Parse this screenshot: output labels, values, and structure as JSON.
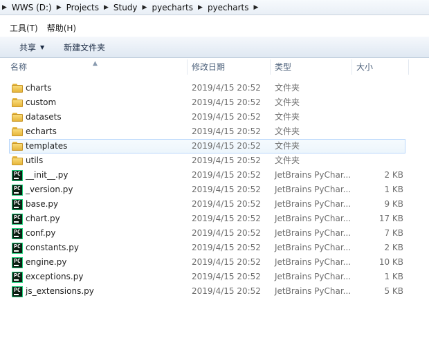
{
  "address": {
    "crumbs": [
      "WWS (D:)",
      "Projects",
      "Study",
      "pyecharts",
      "pyecharts"
    ]
  },
  "menu": {
    "items": [
      "工具(T)",
      "帮助(H)"
    ]
  },
  "toolbar": {
    "share_label": "共享",
    "new_folder_label": "新建文件夹"
  },
  "columns": {
    "name": "名称",
    "date": "修改日期",
    "type": "类型",
    "size": "大小"
  },
  "files": [
    {
      "name": "charts",
      "date": "2019/4/15 20:52",
      "type": "文件夹",
      "size": "",
      "icon": "folder-icon"
    },
    {
      "name": "custom",
      "date": "2019/4/15 20:52",
      "type": "文件夹",
      "size": "",
      "icon": "folder-icon"
    },
    {
      "name": "datasets",
      "date": "2019/4/15 20:52",
      "type": "文件夹",
      "size": "",
      "icon": "folder-icon"
    },
    {
      "name": "echarts",
      "date": "2019/4/15 20:52",
      "type": "文件夹",
      "size": "",
      "icon": "folder-icon"
    },
    {
      "name": "templates",
      "date": "2019/4/15 20:52",
      "type": "文件夹",
      "size": "",
      "icon": "folder-icon",
      "hover": true
    },
    {
      "name": "utils",
      "date": "2019/4/15 20:52",
      "type": "文件夹",
      "size": "",
      "icon": "folder-icon"
    },
    {
      "name": "__init__.py",
      "date": "2019/4/15 20:52",
      "type": "JetBrains PyChar...",
      "size": "2 KB",
      "icon": "pycharm-file-icon"
    },
    {
      "name": "_version.py",
      "date": "2019/4/15 20:52",
      "type": "JetBrains PyChar...",
      "size": "1 KB",
      "icon": "pycharm-file-icon"
    },
    {
      "name": "base.py",
      "date": "2019/4/15 20:52",
      "type": "JetBrains PyChar...",
      "size": "9 KB",
      "icon": "pycharm-file-icon"
    },
    {
      "name": "chart.py",
      "date": "2019/4/15 20:52",
      "type": "JetBrains PyChar...",
      "size": "17 KB",
      "icon": "pycharm-file-icon"
    },
    {
      "name": "conf.py",
      "date": "2019/4/15 20:52",
      "type": "JetBrains PyChar...",
      "size": "7 KB",
      "icon": "pycharm-file-icon"
    },
    {
      "name": "constants.py",
      "date": "2019/4/15 20:52",
      "type": "JetBrains PyChar...",
      "size": "2 KB",
      "icon": "pycharm-file-icon"
    },
    {
      "name": "engine.py",
      "date": "2019/4/15 20:52",
      "type": "JetBrains PyChar...",
      "size": "10 KB",
      "icon": "pycharm-file-icon"
    },
    {
      "name": "exceptions.py",
      "date": "2019/4/15 20:52",
      "type": "JetBrains PyChar...",
      "size": "1 KB",
      "icon": "pycharm-file-icon"
    },
    {
      "name": "js_extensions.py",
      "date": "2019/4/15 20:52",
      "type": "JetBrains PyChar...",
      "size": "5 KB",
      "icon": "pycharm-file-icon"
    }
  ]
}
